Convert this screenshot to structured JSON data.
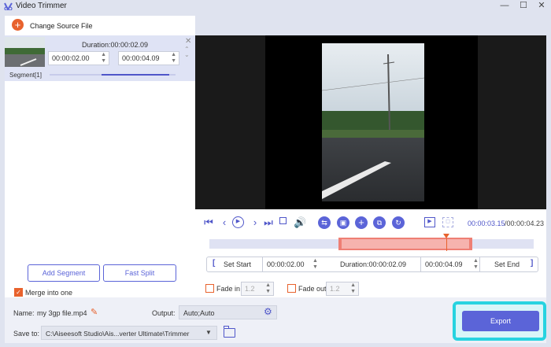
{
  "window": {
    "title": "Video Trimmer",
    "minimize": "—",
    "maximize": "☐",
    "close": "✕"
  },
  "source": {
    "change_label": "Change Source File"
  },
  "segment": {
    "duration": "Duration:00:00:02.09",
    "start": "00:00:02.00",
    "end": "00:00:04.09",
    "label": "Segment[1]"
  },
  "left_buttons": {
    "add_segment": "Add Segment",
    "fast_split": "Fast Split",
    "merge": "Merge into one"
  },
  "timecode": {
    "current": "00:00:03.15",
    "total": "/00:00:04.23"
  },
  "trim": {
    "set_start": "Set Start",
    "start": "00:00:02.00",
    "duration": "Duration:00:00:02.09",
    "end": "00:00:04.09",
    "set_end": "Set End"
  },
  "fade": {
    "fade_in": "Fade in",
    "fade_in_value": "1.2",
    "fade_out": "Fade out",
    "fade_out_value": "1.2"
  },
  "output": {
    "name_label": "Name:",
    "name_value": "my 3gp file.mp4",
    "output_label": "Output:",
    "output_value": "Auto;Auto",
    "save_label": "Save to:",
    "save_value": "C:\\Aiseesoft Studio\\Ais...verter Ultimate\\Trimmer",
    "export": "Export"
  },
  "colors": {
    "accent": "#5b64d8",
    "orange": "#e8622d",
    "highlight": "#27d3e0",
    "selection": "#f6b3ae"
  }
}
